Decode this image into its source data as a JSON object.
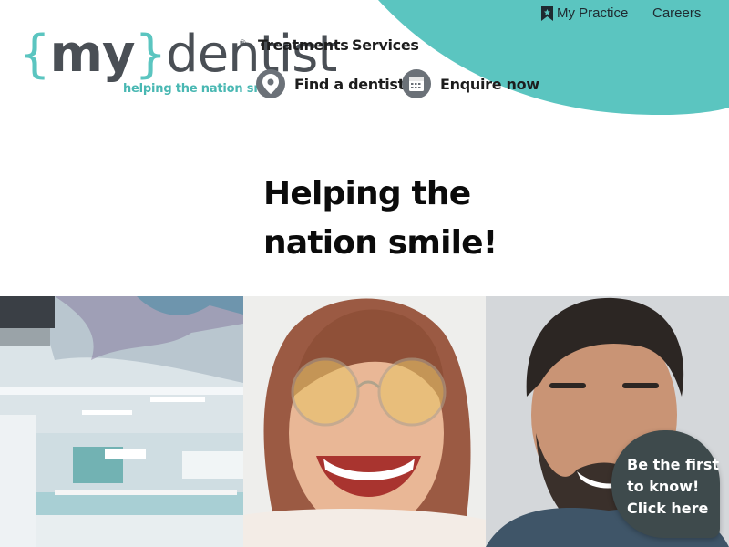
{
  "colors": {
    "teal": "#5bc5c0",
    "dark_grey": "#4a4f55",
    "bubble": "#3e4a4c"
  },
  "utility_nav": {
    "my_practice": "My Practice",
    "careers": "Careers"
  },
  "logo": {
    "left_brace": "{",
    "my": "my",
    "right_brace": "}",
    "dentist": "dentist",
    "registered": "®",
    "tagline": "helping the nation smile"
  },
  "main_nav": {
    "treatments": "Treatments",
    "services": "Services",
    "find_dentist": "Find a dentist",
    "enquire": "Enquire now"
  },
  "hero": {
    "line1": "Helping the",
    "line2": "nation smile!"
  },
  "icons": {
    "practice": "bookmark-icon",
    "find": "map-pin-icon",
    "enquire": "calendar-icon"
  },
  "bubble": {
    "line1": "Be the first",
    "line2": "to know!",
    "line3": "Click here"
  }
}
